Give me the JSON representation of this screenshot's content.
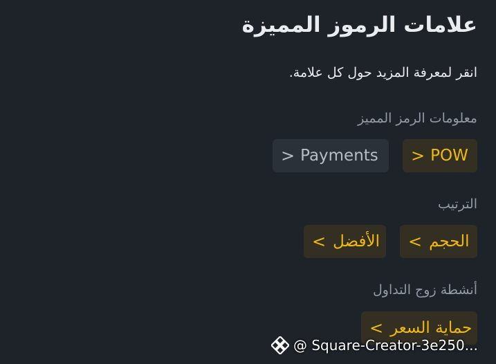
{
  "header": {
    "title": "علامات الرموز المميزة",
    "subtitle": "انقر لمعرفة المزيد حول كل علامة."
  },
  "sections": {
    "token_info": {
      "label": "معلومات الرمز المميز",
      "tags": [
        {
          "label": "POW",
          "chevron": ">"
        },
        {
          "label": "Payments",
          "chevron": ">"
        }
      ]
    },
    "ranking": {
      "label": "الترتيب",
      "tags": [
        {
          "label": "الحجم",
          "chevron": ">"
        },
        {
          "label": "الأفضل",
          "chevron": ">"
        }
      ]
    },
    "trading_pair": {
      "label": "أنشطة زوج التداول",
      "tags": [
        {
          "label": "حماية السعر",
          "chevron": ">"
        }
      ]
    }
  },
  "watermark": {
    "text": "@ Square-Creator-3e250...",
    "icon": "binance-logo-icon"
  },
  "colors": {
    "background": "#1e2329",
    "accent_gold": "#f0b90b",
    "chip_gold_bg": "#332f23",
    "chip_gray_bg": "#2b3139",
    "muted_text": "#929aa5"
  }
}
